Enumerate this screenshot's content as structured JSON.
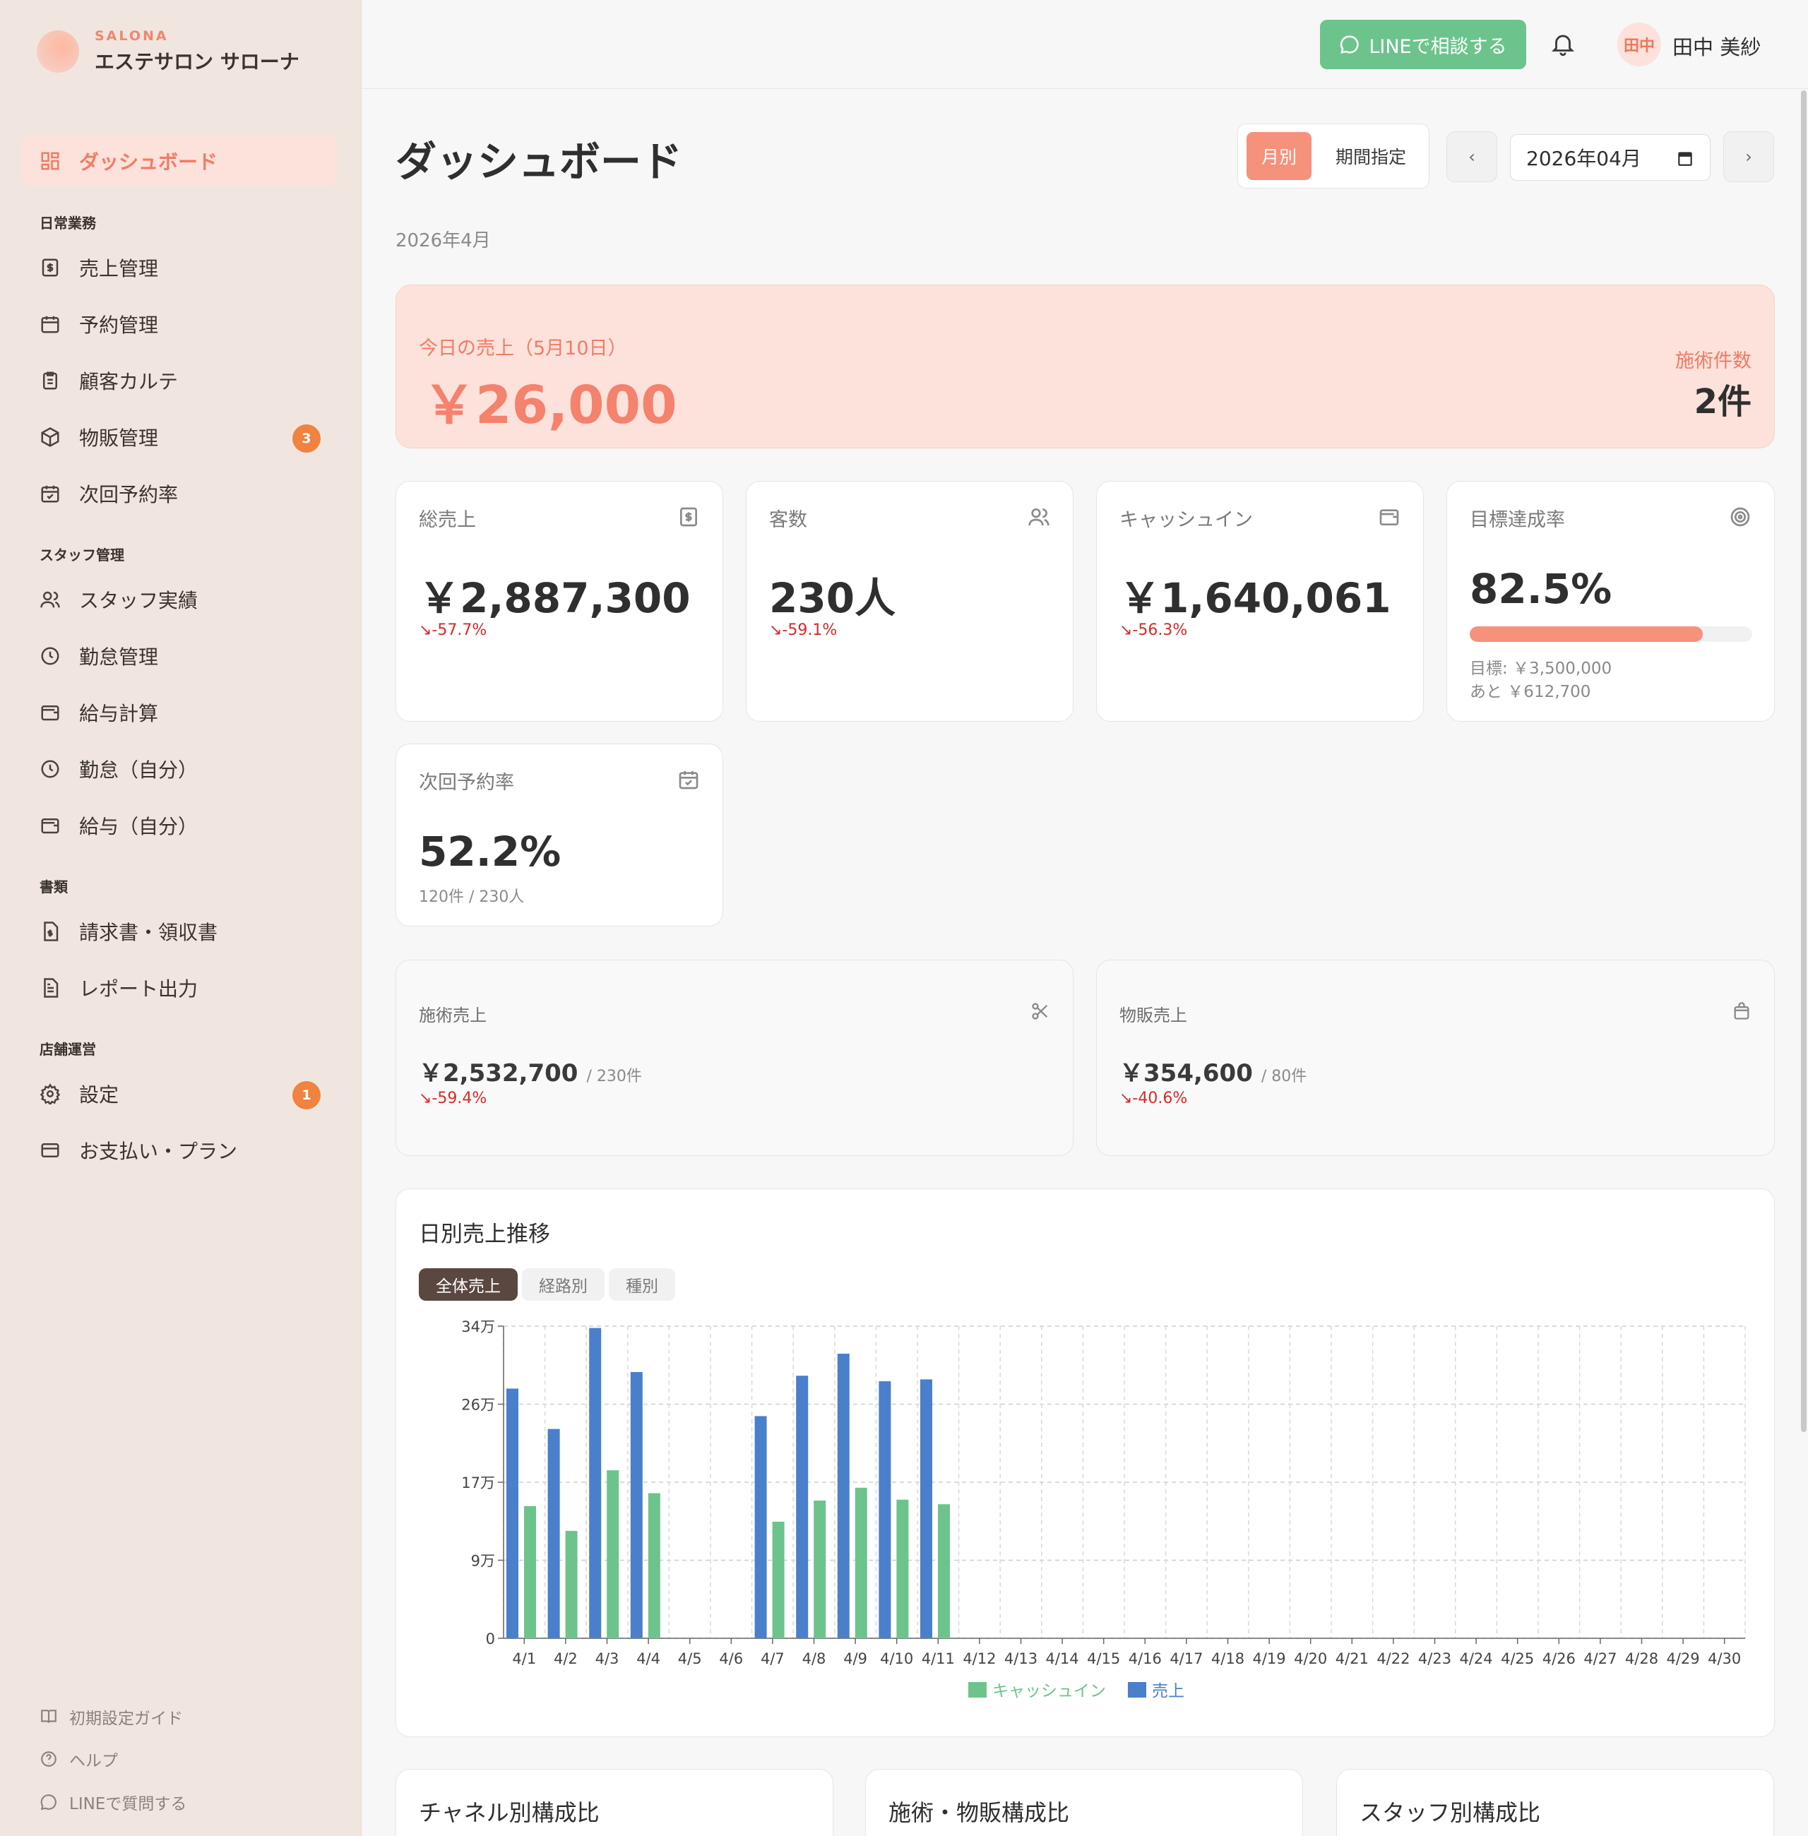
{
  "brand": {
    "sub": "SALONA",
    "name": "エステサロン サローナ"
  },
  "sidebar": {
    "active": {
      "label": "ダッシュボード"
    },
    "sections": [
      {
        "label": "日常業務"
      },
      {
        "label": "スタッフ管理"
      },
      {
        "label": "書類"
      },
      {
        "label": "店舗運営"
      }
    ],
    "items": [
      {
        "label": "売上管理",
        "icon": "dollar-doc-icon"
      },
      {
        "label": "予約管理",
        "icon": "calendar-icon"
      },
      {
        "label": "顧客カルテ",
        "icon": "clipboard-icon"
      },
      {
        "label": "物販管理",
        "icon": "box-icon",
        "badge": "3"
      },
      {
        "label": "次回予約率",
        "icon": "calendar-check-icon"
      },
      {
        "label": "スタッフ実績",
        "icon": "users-icon"
      },
      {
        "label": "勤怠管理",
        "icon": "clock-icon"
      },
      {
        "label": "給与計算",
        "icon": "wallet-icon"
      },
      {
        "label": "勤怠（自分）",
        "icon": "clock-icon"
      },
      {
        "label": "給与（自分）",
        "icon": "wallet-icon"
      },
      {
        "label": "請求書・領収書",
        "icon": "file-dollar-icon"
      },
      {
        "label": "レポート出力",
        "icon": "file-text-icon"
      },
      {
        "label": "設定",
        "icon": "gear-icon",
        "badge": "1"
      },
      {
        "label": "お支払い・プラン",
        "icon": "credit-card-icon"
      }
    ],
    "footer": [
      {
        "label": "初期設定ガイド"
      },
      {
        "label": "ヘルプ"
      },
      {
        "label": "LINEで質問する"
      }
    ]
  },
  "header": {
    "line_button": "LINEで相談する",
    "avatar": "田中",
    "user_name": "田中 美紗"
  },
  "page": {
    "title": "ダッシュボード",
    "subtitle": "2026年4月",
    "seg_monthly": "月別",
    "seg_range": "期間指定",
    "prev": "‹",
    "next": "›",
    "month_value": "2026年04月"
  },
  "today": {
    "label": "今日の売上（5月10日）",
    "value": "￥26,000",
    "count_label": "施術件数",
    "count_value": "2件"
  },
  "kpis": [
    {
      "label": "総売上",
      "value": "￥2,887,300",
      "delta": "↘-57.7%"
    },
    {
      "label": "客数",
      "value": "230人",
      "delta": "↘-59.1%"
    },
    {
      "label": "キャッシュイン",
      "value": "￥1,640,061",
      "delta": "↘-56.3%"
    },
    {
      "label": "目標達成率",
      "value": "82.5%",
      "progress": 0.825,
      "target": "目標: ￥3,500,000",
      "remaining": "あと ￥612,700"
    },
    {
      "label": "次回予約率",
      "value": "52.2%",
      "note": "120件 / 230人"
    }
  ],
  "subsales": [
    {
      "label": "施術売上",
      "value": "￥2,532,700",
      "count": "/ 230件",
      "delta": "↘-59.4%"
    },
    {
      "label": "物販売上",
      "value": "￥354,600",
      "count": "/ 80件",
      "delta": "↘-40.6%"
    }
  ],
  "chart_section": {
    "title": "日別売上推移",
    "tabs": [
      "全体売上",
      "経路別",
      "種別"
    ]
  },
  "chart_data": {
    "type": "bar",
    "categories": [
      "4/1",
      "4/2",
      "4/3",
      "4/4",
      "4/5",
      "4/6",
      "4/7",
      "4/8",
      "4/9",
      "4/10",
      "4/11",
      "4/12",
      "4/13",
      "4/14",
      "4/15",
      "4/16",
      "4/17",
      "4/18",
      "4/19",
      "4/20",
      "4/21",
      "4/22",
      "4/23",
      "4/24",
      "4/25",
      "4/26",
      "4/27",
      "4/28",
      "4/29",
      "4/30"
    ],
    "series": [
      {
        "name": "売上",
        "color": "#4a7fcb",
        "values": [
          272000,
          228000,
          338000,
          290000,
          0,
          0,
          242000,
          286000,
          310000,
          280000,
          282000,
          0,
          0,
          0,
          0,
          0,
          0,
          0,
          0,
          0,
          0,
          0,
          0,
          0,
          0,
          0,
          0,
          0,
          0,
          0
        ]
      },
      {
        "name": "キャッシュイン",
        "color": "#6cc48c",
        "values": [
          144000,
          117000,
          183000,
          158000,
          0,
          0,
          127000,
          150000,
          164000,
          151000,
          146000,
          0,
          0,
          0,
          0,
          0,
          0,
          0,
          0,
          0,
          0,
          0,
          0,
          0,
          0,
          0,
          0,
          0,
          0,
          0
        ]
      }
    ],
    "yticks": [
      "0",
      "9万",
      "17万",
      "26万",
      "34万"
    ],
    "ylim": [
      0,
      340000
    ],
    "grid": true,
    "legend": [
      "キャッシュイン",
      "売上"
    ],
    "legend_placement": "bottom-center"
  },
  "bottom_cards": [
    "チャネル別構成比",
    "施術・物販構成比",
    "スタッフ別構成比"
  ]
}
